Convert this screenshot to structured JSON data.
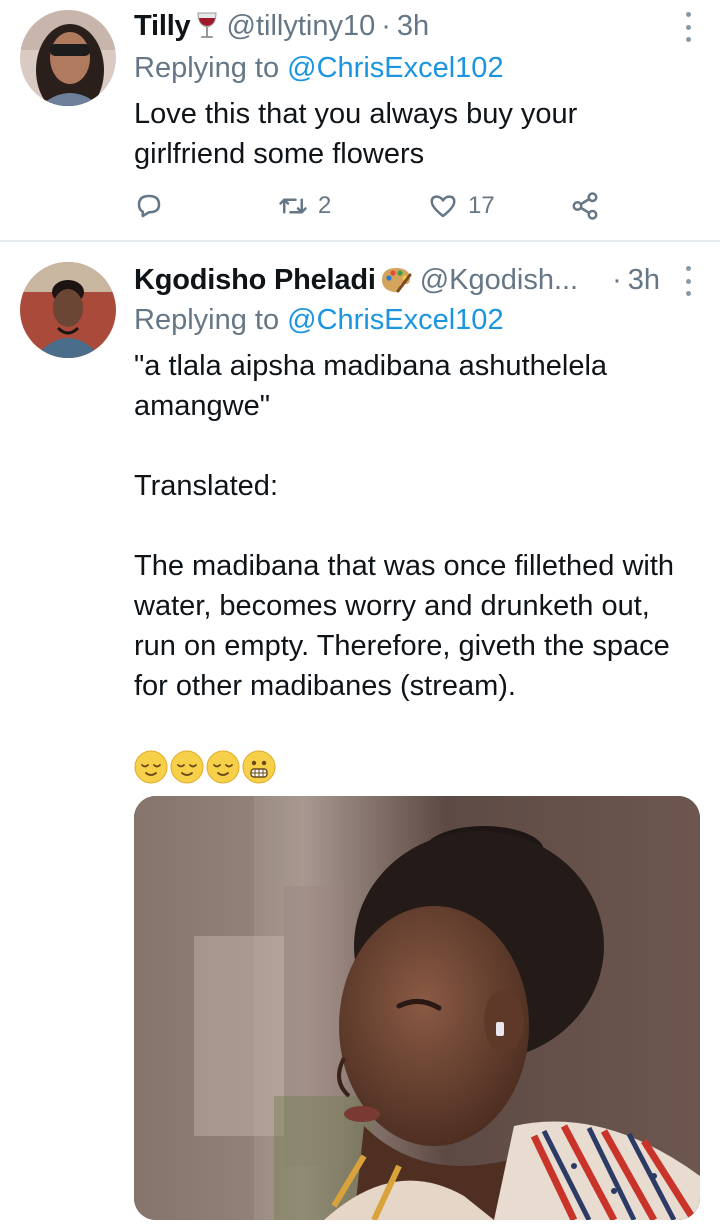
{
  "tweets": [
    {
      "name": "Tilly",
      "name_emoji": "wine-glass-icon",
      "handle": "@tillytiny10",
      "separator": "·",
      "time": "3h",
      "replying_prefix": "Replying to",
      "replying_to": "@ChrisExcel102",
      "text": [
        "Love this that you always buy your girlfriend some flowers"
      ],
      "actions": {
        "reply_count": "",
        "retweet_count": "2",
        "like_count": "17"
      }
    },
    {
      "name": "Kgodisho Pheladi",
      "name_emoji": "artist-palette-icon",
      "handle": "@Kgodish...",
      "separator": "·",
      "time": "3h",
      "replying_prefix": "Replying to",
      "replying_to": "@ChrisExcel102",
      "text": [
        "\"a tlala aipsha madibana ashuthelela amangwe\"",
        "Translated:",
        "The madibana that was once fillethed with water, becomes worry and drunketh out, run on empty. Therefore, giveth the space for other madibanes (stream)."
      ],
      "emojis": [
        "relieved-face-icon",
        "relieved-face-icon",
        "relieved-face-icon",
        "grimacing-face-icon"
      ],
      "media": "photo-woman-profile"
    }
  ],
  "colors": {
    "link": "#1b95e0",
    "secondary": "#657786",
    "text": "#0f1419",
    "divider": "#e6ecf0"
  }
}
